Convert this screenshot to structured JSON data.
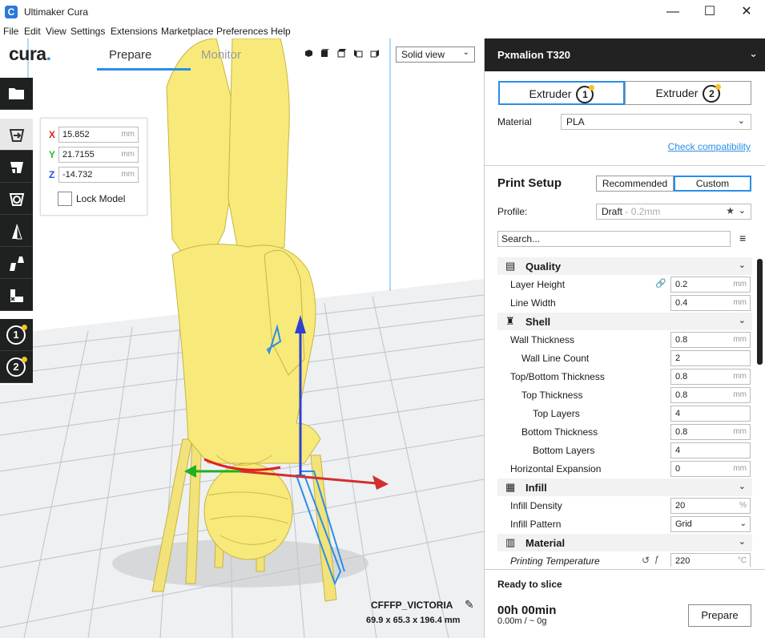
{
  "window": {
    "title": "Ultimaker Cura",
    "app_icon": "C",
    "minimize": "—",
    "maximize": "☐",
    "close": "✕"
  },
  "menu": [
    "File",
    "Edit",
    "View",
    "Settings",
    "Extensions",
    "Marketplace",
    "Preferences",
    "Help"
  ],
  "header": {
    "logo": "cura",
    "logo_dot": ".",
    "stages": {
      "prepare": "Prepare",
      "monitor": "Monitor"
    },
    "view_mode": "Solid view",
    "chevron": "⌄"
  },
  "toolbar": {
    "tools": [
      "open-file",
      "move",
      "scale",
      "rotate",
      "mirror",
      "per-model-settings",
      "support-blocker"
    ],
    "extruders": [
      "1",
      "2"
    ],
    "accent_color": "#f8c020"
  },
  "move_panel": {
    "x": {
      "label": "X",
      "value": "15.852",
      "unit": "mm",
      "color": "#e02020"
    },
    "y": {
      "label": "Y",
      "value": "21.7155",
      "unit": "mm",
      "color": "#20c020"
    },
    "z": {
      "label": "Z",
      "value": "-14.732",
      "unit": "mm",
      "color": "#2050e0"
    },
    "lock_label": "Lock Model"
  },
  "object": {
    "name": "CFFFP_VICTORIA",
    "dims": "69.9 x 65.3 x 196.4 mm",
    "edit_icon": "✎"
  },
  "sidebar": {
    "printer": "Pxmalion T320",
    "printer_chevron": "⌄",
    "extruders": [
      {
        "label": "Extruder",
        "num": "1"
      },
      {
        "label": "Extruder",
        "num": "2"
      }
    ],
    "material_label": "Material",
    "material_value": "PLA",
    "check_compat": "Check compatibility",
    "print_setup": "Print Setup",
    "mode_recommended": "Recommended",
    "mode_custom": "Custom",
    "profile_label": "Profile:",
    "profile_value": "Draft",
    "profile_sub": "- 0.2mm",
    "star": "★",
    "search_placeholder": "Search...",
    "menu_icon": "≡"
  },
  "settings": {
    "quality": {
      "label": "Quality",
      "icon": "▤"
    },
    "layer_height": {
      "label": "Layer Height",
      "value": "0.2",
      "unit": "mm",
      "link": "🔗"
    },
    "line_width": {
      "label": "Line Width",
      "value": "0.4",
      "unit": "mm"
    },
    "shell": {
      "label": "Shell",
      "icon": "♜"
    },
    "wall_thickness": {
      "label": "Wall Thickness",
      "value": "0.8",
      "unit": "mm"
    },
    "wall_line_count": {
      "label": "Wall Line Count",
      "value": "2"
    },
    "topbottom_thickness": {
      "label": "Top/Bottom Thickness",
      "value": "0.8",
      "unit": "mm"
    },
    "top_thickness": {
      "label": "Top Thickness",
      "value": "0.8",
      "unit": "mm"
    },
    "top_layers": {
      "label": "Top Layers",
      "value": "4"
    },
    "bottom_thickness": {
      "label": "Bottom Thickness",
      "value": "0.8",
      "unit": "mm"
    },
    "bottom_layers": {
      "label": "Bottom Layers",
      "value": "4"
    },
    "horizontal_expansion": {
      "label": "Horizontal Expansion",
      "value": "0",
      "unit": "mm"
    },
    "infill": {
      "label": "Infill",
      "icon": "▦"
    },
    "infill_density": {
      "label": "Infill Density",
      "value": "20",
      "unit": "%"
    },
    "infill_pattern": {
      "label": "Infill Pattern",
      "value": "Grid"
    },
    "material": {
      "label": "Material",
      "icon": "▥"
    },
    "printing_temperature": {
      "label": "Printing Temperature",
      "value": "220",
      "unit": "°C",
      "reset": "↺",
      "fx": "ƒ"
    }
  },
  "footer": {
    "status": "Ready to slice",
    "time": "00h 00min",
    "material_est": "0.00m / ~ 0g",
    "button": "Prepare"
  }
}
